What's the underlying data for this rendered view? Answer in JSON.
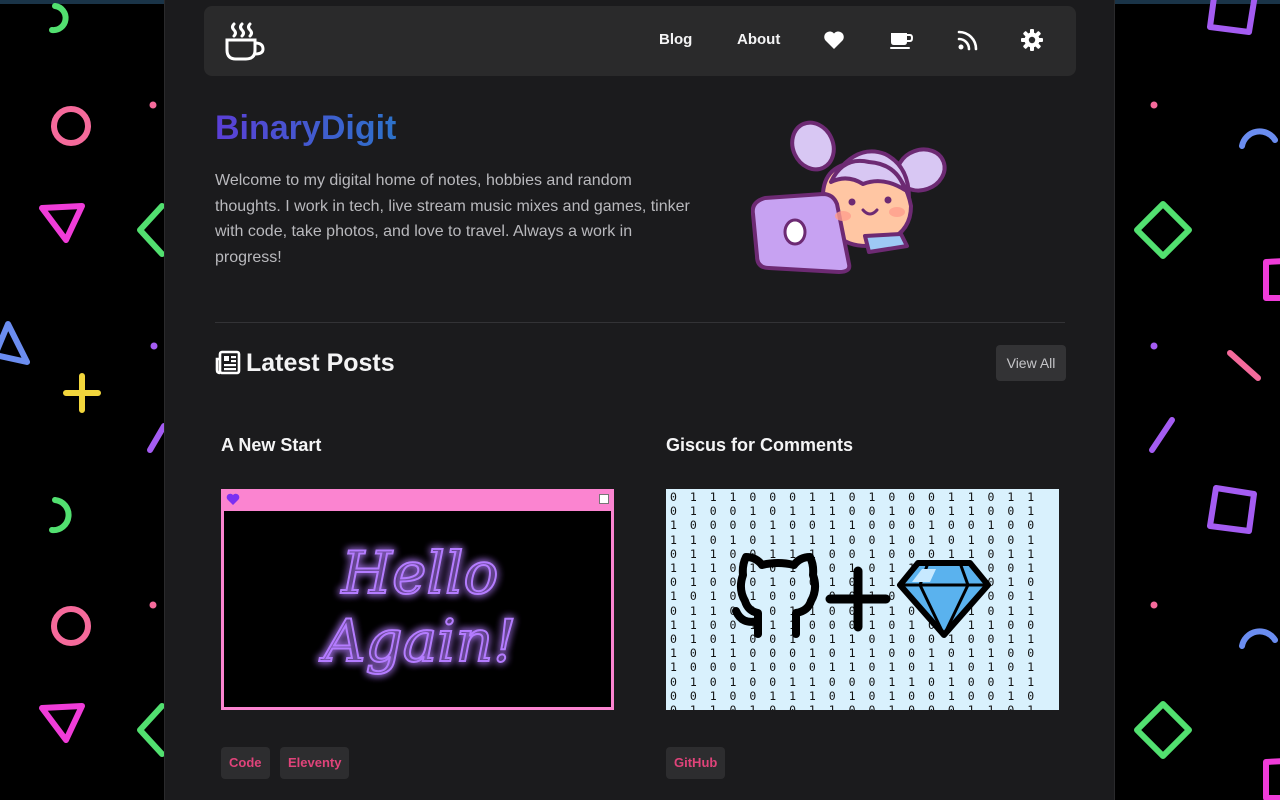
{
  "nav": {
    "logo_icon": "coffee-steam-icon",
    "links": [
      {
        "label": "Blog"
      },
      {
        "label": "About"
      }
    ],
    "icons": [
      "heart-icon",
      "coffee-cup-icon",
      "rss-icon",
      "gear-icon"
    ]
  },
  "hero": {
    "title": "BinaryDigit",
    "description": "Welcome to my digital home of notes, hobbies and random thoughts. I work in tech, live stream music mixes and games, tinker with code, take photos, and love to travel. Always a work in progress!",
    "avatar_icon": "character-with-laptop-illustration"
  },
  "latest": {
    "icon": "newspaper-icon",
    "title": "Latest Posts",
    "view_all_label": "View All"
  },
  "posts": [
    {
      "title": "A New Start",
      "image_text_line1": "Hello",
      "image_text_line2": "Again!",
      "tags": [
        "Code",
        "Eleventy"
      ]
    },
    {
      "title": "Giscus for Comments",
      "image_icons": [
        "github-octocat-icon",
        "plus-icon",
        "gem-icon"
      ],
      "tags": [
        "GitHub"
      ]
    }
  ],
  "colors": {
    "page_bg": "#1b1b1d",
    "nav_bg": "#2a2a2b",
    "title_gradient_start": "#5b3fd6",
    "title_gradient_end": "#2d72c9",
    "tag_text": "#e0437a",
    "neon_purple": "#b47cff",
    "window_pink": "#fb84d0"
  }
}
